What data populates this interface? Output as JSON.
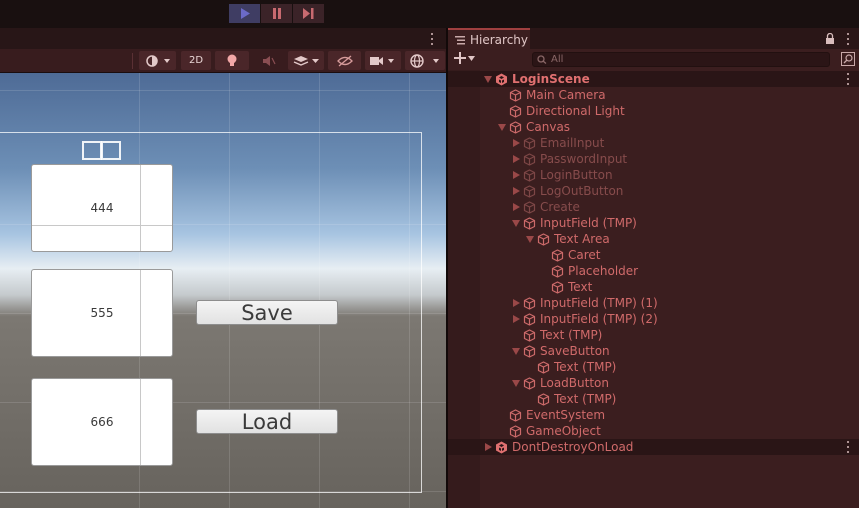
{
  "playbar": {
    "buttons": [
      {
        "name": "play",
        "active": true
      },
      {
        "name": "pause",
        "active": false
      },
      {
        "name": "step",
        "active": false
      }
    ]
  },
  "scene_toolbar": {
    "mode_2d_label": "2D"
  },
  "scene_view": {
    "cards": [
      {
        "value": "444"
      },
      {
        "value": "555"
      },
      {
        "value": "666"
      }
    ],
    "buttons": {
      "save_label": "Save",
      "load_label": "Load"
    }
  },
  "hierarchy": {
    "tab_label": "Hierarchy",
    "search_placeholder": "All",
    "items": [
      {
        "label": "LoginScene",
        "depth": 0,
        "expanded": true,
        "kind": "scene",
        "active": true
      },
      {
        "label": "Main Camera",
        "depth": 1,
        "kind": "object",
        "active": true
      },
      {
        "label": "Directional Light",
        "depth": 1,
        "kind": "object",
        "active": true
      },
      {
        "label": "Canvas",
        "depth": 1,
        "expanded": true,
        "kind": "object",
        "active": true
      },
      {
        "label": "EmailInput",
        "depth": 2,
        "expanded": false,
        "kind": "object",
        "active": false
      },
      {
        "label": "PasswordInput",
        "depth": 2,
        "expanded": false,
        "kind": "object",
        "active": false
      },
      {
        "label": "LoginButton",
        "depth": 2,
        "expanded": false,
        "kind": "object",
        "active": false
      },
      {
        "label": "LogOutButton",
        "depth": 2,
        "expanded": false,
        "kind": "object",
        "active": false
      },
      {
        "label": "Create",
        "depth": 2,
        "expanded": false,
        "kind": "object",
        "active": false
      },
      {
        "label": "InputField (TMP)",
        "depth": 2,
        "expanded": true,
        "kind": "object",
        "active": true
      },
      {
        "label": "Text Area",
        "depth": 3,
        "expanded": true,
        "kind": "object",
        "active": true
      },
      {
        "label": "Caret",
        "depth": 4,
        "kind": "object",
        "active": true
      },
      {
        "label": "Placeholder",
        "depth": 4,
        "kind": "object",
        "active": true
      },
      {
        "label": "Text",
        "depth": 4,
        "kind": "object",
        "active": true
      },
      {
        "label": "InputField (TMP) (1)",
        "depth": 2,
        "expanded": false,
        "kind": "object",
        "active": true
      },
      {
        "label": "InputField (TMP) (2)",
        "depth": 2,
        "expanded": false,
        "kind": "object",
        "active": true
      },
      {
        "label": "Text (TMP)",
        "depth": 2,
        "kind": "object",
        "active": true
      },
      {
        "label": "SaveButton",
        "depth": 2,
        "expanded": true,
        "kind": "object",
        "active": true
      },
      {
        "label": "Text (TMP)",
        "depth": 3,
        "kind": "object",
        "active": true
      },
      {
        "label": "LoadButton",
        "depth": 2,
        "expanded": true,
        "kind": "object",
        "active": true
      },
      {
        "label": "Text (TMP)",
        "depth": 3,
        "kind": "object",
        "active": true
      },
      {
        "label": "EventSystem",
        "depth": 1,
        "kind": "object",
        "active": true
      },
      {
        "label": "GameObject",
        "depth": 1,
        "kind": "object",
        "active": true
      },
      {
        "label": "DontDestroyOnLoad",
        "depth": 0,
        "expanded": false,
        "kind": "scene",
        "active": true
      }
    ]
  },
  "colors": {
    "accent": "#d06a6a",
    "inactive": "#874c4c",
    "panel": "#3b1e1f",
    "play_active": "#3f3d63"
  },
  "icons": [
    "play-icon",
    "pause-icon",
    "step-icon",
    "kebab-menu-icon",
    "hierarchy-list-icon",
    "lock-icon",
    "add-icon",
    "search-icon",
    "cube-icon",
    "unity-scene-icon"
  ]
}
